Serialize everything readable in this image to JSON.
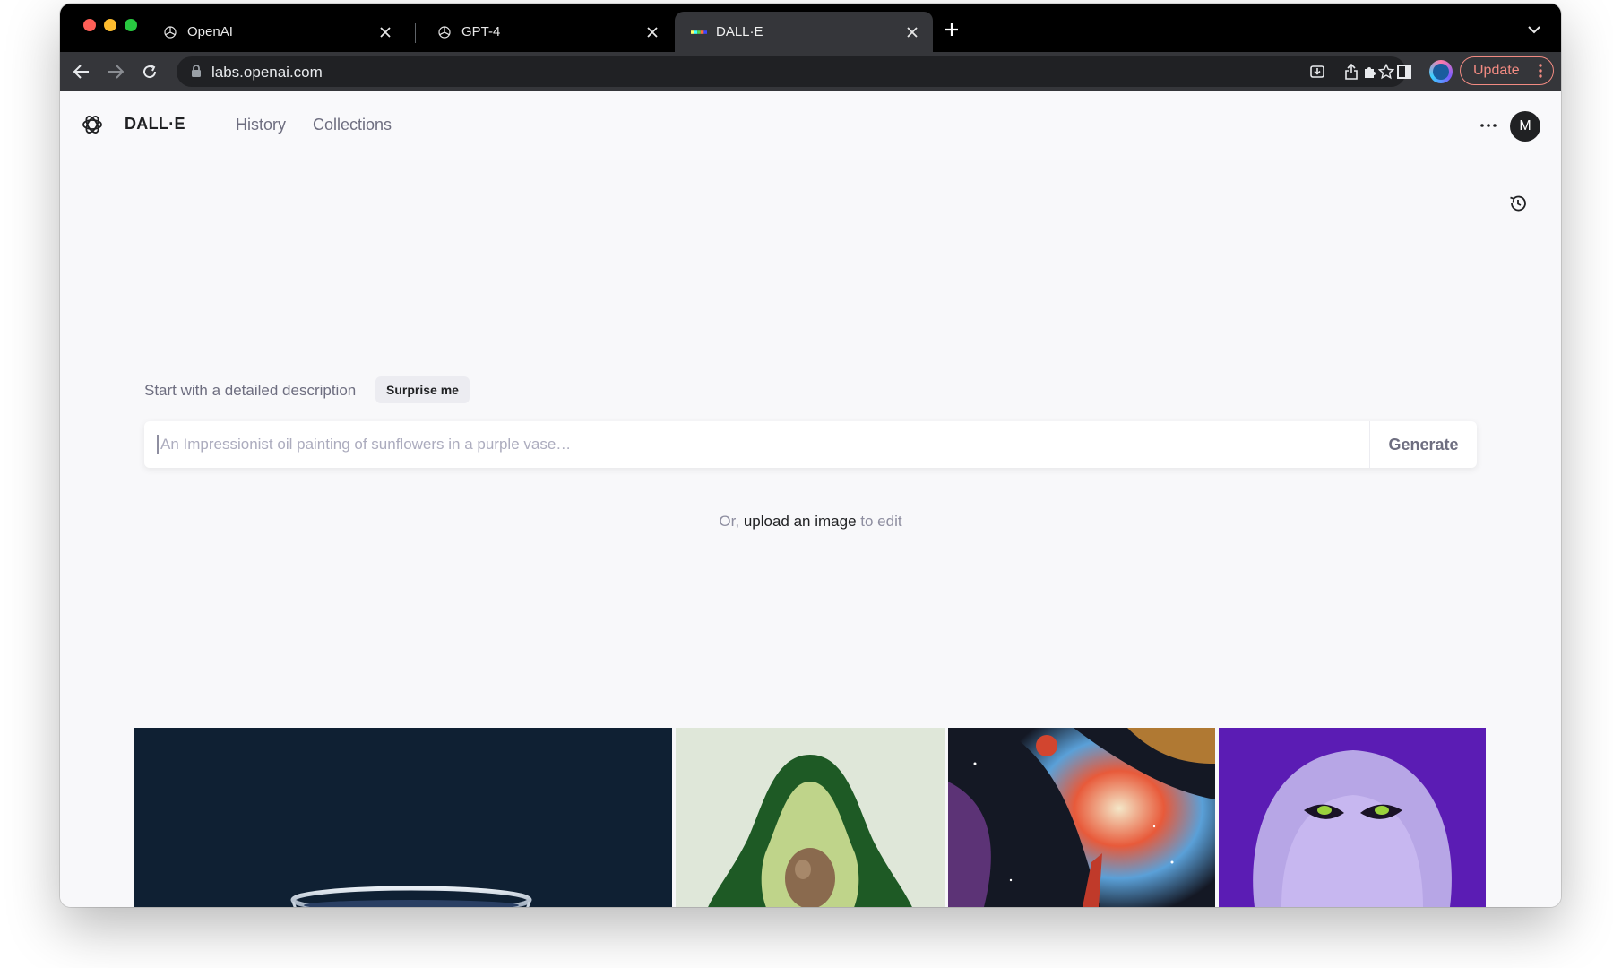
{
  "browser": {
    "tabs": [
      {
        "title": "OpenAI",
        "favicon": "openai-icon",
        "active": false
      },
      {
        "title": "GPT-4",
        "favicon": "openai-icon",
        "active": false
      },
      {
        "title": "DALL·E",
        "favicon": "dalle-color-bar-icon",
        "active": true
      }
    ],
    "url": "labs.openai.com",
    "update_label": "Update",
    "colors": {
      "tabstrip": "#000000",
      "toolbar": "#35363a",
      "omnibox": "#202124",
      "update_accent": "#f28b82"
    }
  },
  "app": {
    "brand": "DALL·E",
    "nav": [
      "History",
      "Collections"
    ],
    "avatar_initial": "M",
    "prompt_label": "Start with a detailed description",
    "surprise_label": "Surprise me",
    "prompt_placeholder": "An Impressionist oil painting of sunflowers in a purple vase…",
    "generate_label": "Generate",
    "upload": {
      "prefix": "Or,",
      "link": "upload an image",
      "suffix": "to edit"
    },
    "gallery": [
      {
        "name": "glass-bowl-image",
        "description_icon": "image"
      },
      {
        "name": "avocado-chair-image",
        "description_icon": "image"
      },
      {
        "name": "cosmic-painting-image",
        "description_icon": "image"
      },
      {
        "name": "purple-monster-image",
        "description_icon": "image"
      }
    ]
  }
}
